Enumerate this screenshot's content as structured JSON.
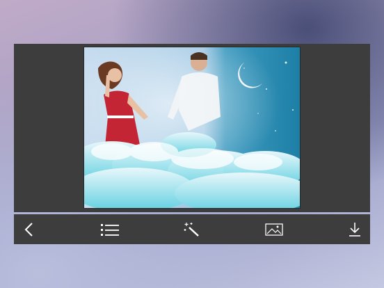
{
  "canvas": {
    "background": "#a9a1c4"
  },
  "editor": {
    "panel_color": "#3d3d3d",
    "photo": {
      "description_icon": "photo-collage"
    }
  },
  "toolbar": {
    "items": [
      {
        "name": "back-button",
        "icon": "chevron-left-icon"
      },
      {
        "name": "list-button",
        "icon": "list-icon"
      },
      {
        "name": "magic-wand-button",
        "icon": "magic-wand-icon"
      },
      {
        "name": "gallery-button",
        "icon": "image-icon"
      },
      {
        "name": "download-button",
        "icon": "download-icon"
      }
    ],
    "icon_color": "#ffffff"
  }
}
